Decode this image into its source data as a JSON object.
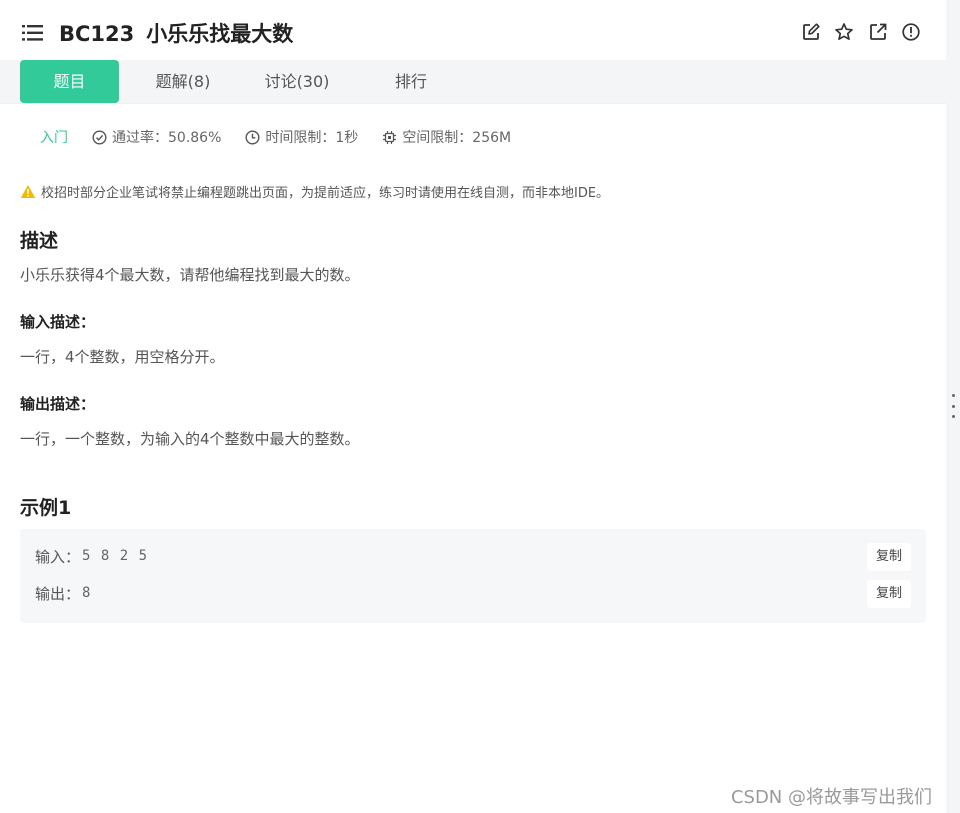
{
  "header": {
    "code": "BC123",
    "title": "小乐乐找最大数",
    "icons": [
      "edit-icon",
      "star-icon",
      "external-link-icon",
      "report-icon"
    ]
  },
  "tabs": [
    {
      "label": "题目",
      "active": true
    },
    {
      "label": "题解(8)",
      "active": false
    },
    {
      "label": "讨论(30)",
      "active": false
    },
    {
      "label": "排行",
      "active": false
    }
  ],
  "meta": {
    "level": "入门",
    "pass_rate": "通过率：50.86%",
    "time_limit": "时间限制：1秒",
    "space_limit": "空间限制：256M"
  },
  "notice": "校招时部分企业笔试将禁止编程题跳出页面，为提前适应，练习时请使用在线自测，而非本地IDE。",
  "description": {
    "heading": "描述",
    "text": "小乐乐获得4个最大数，请帮他编程找到最大的数。",
    "input_heading": "输入描述：",
    "input_text": "一行，4个整数，用空格分开。",
    "output_heading": "输出描述：",
    "output_text": "一行，一个整数，为输入的4个整数中最大的整数。"
  },
  "example": {
    "heading": "示例1",
    "input_label": "输入：",
    "input_value": "5 8 2 5",
    "output_label": "输出：",
    "output_value": "8",
    "copy_label": "复制"
  },
  "watermark": "CSDN @将故事写出我们",
  "colors": {
    "accent": "#32ca99",
    "warning": "#f5b800",
    "tabbar_bg": "#f4f5f7",
    "example_bg": "#f6f7f9"
  }
}
